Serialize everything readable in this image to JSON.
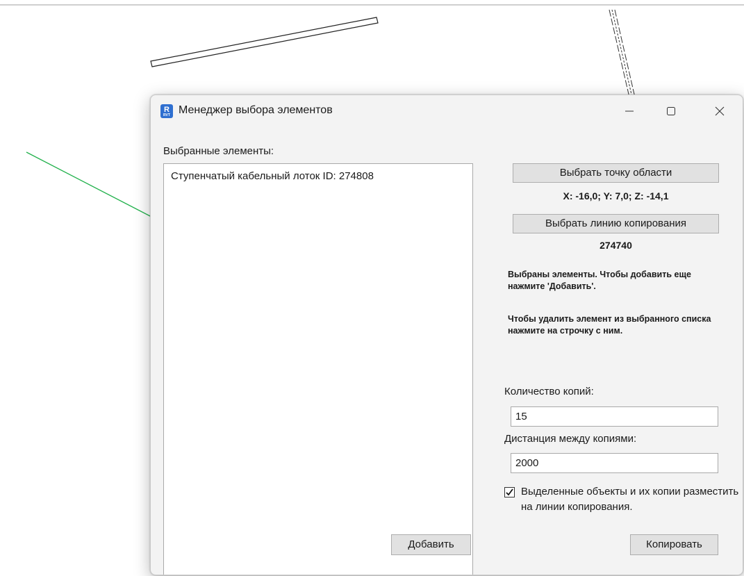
{
  "window": {
    "title": "Менеджер выбора элементов",
    "icon": "revit-app-icon",
    "icon_text": "R",
    "icon_subtext": "RVT"
  },
  "selected": {
    "label": "Выбранные элементы:",
    "items": [
      "Ступенчатый кабельный лоток ID: 274808"
    ]
  },
  "point": {
    "button_label": "Выбрать точку области",
    "coordinates": "X: -16,0; Y: 7,0; Z: -14,1"
  },
  "line": {
    "button_label": "Выбрать линию копирования",
    "id": "274740"
  },
  "hints": {
    "added": "Выбраны элементы. Чтобы добавить еще нажмите 'Добавить'.",
    "remove": "Чтобы удалить элемент из выбранного списка нажмите на строчку с ним."
  },
  "copies": {
    "label": "Количество копий:",
    "value": "15"
  },
  "distance": {
    "label": "Дистанция между копиями:",
    "value": "2000"
  },
  "place_on_line": {
    "checked": true,
    "label": "Выделенные объекты и их копии разместить на линии копирования."
  },
  "buttons": {
    "add": "Добавить",
    "copy": "Копировать"
  },
  "colors": {
    "accent": "#2f6fd0",
    "green_line": "#22b14c"
  }
}
